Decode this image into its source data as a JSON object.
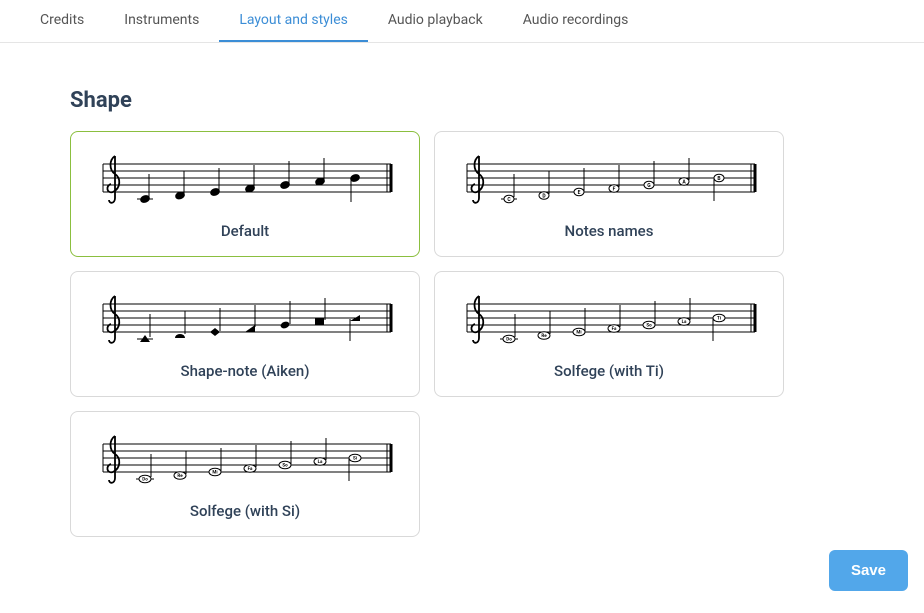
{
  "tabs": [
    {
      "label": "Credits",
      "active": false
    },
    {
      "label": "Instruments",
      "active": false
    },
    {
      "label": "Layout and styles",
      "active": true
    },
    {
      "label": "Audio playback",
      "active": false
    },
    {
      "label": "Audio recordings",
      "active": false
    }
  ],
  "section": {
    "title": "Shape"
  },
  "options": [
    {
      "id": "default",
      "label": "Default",
      "selected": true
    },
    {
      "id": "notes-names",
      "label": "Notes names",
      "selected": false,
      "letters": [
        "C",
        "D",
        "E",
        "F",
        "G",
        "A",
        "B"
      ]
    },
    {
      "id": "shape-note-aiken",
      "label": "Shape-note (Aiken)",
      "selected": false
    },
    {
      "id": "solfege-ti",
      "label": "Solfege (with Ti)",
      "selected": false,
      "letters": [
        "Do",
        "Re",
        "Mi",
        "Fa",
        "So",
        "La",
        "Ti"
      ]
    },
    {
      "id": "solfege-si",
      "label": "Solfege (with Si)",
      "selected": false,
      "letters": [
        "Do",
        "Re",
        "Mi",
        "Fa",
        "So",
        "La",
        "Si"
      ]
    }
  ],
  "actions": {
    "save_label": "Save"
  }
}
